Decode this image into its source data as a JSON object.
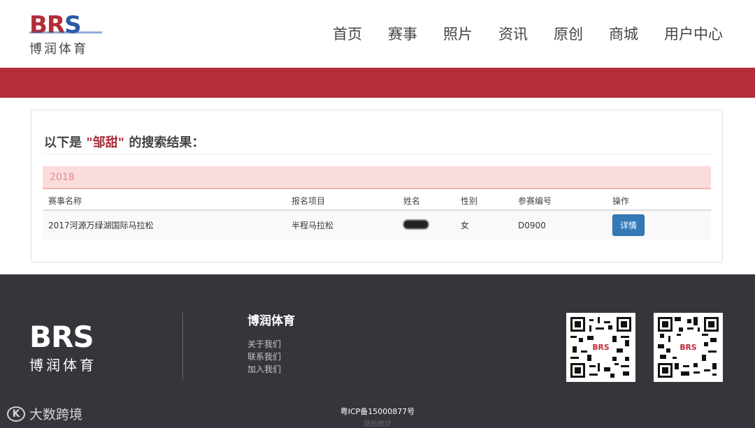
{
  "header": {
    "logo_text": "BRS",
    "logo_cn": "博润体育",
    "nav": [
      "首页",
      "赛事",
      "照片",
      "资讯",
      "原创",
      "商城",
      "用户中心"
    ]
  },
  "results": {
    "title_prefix": "以下是",
    "keyword": "\"邹甜\"",
    "title_suffix": "的搜索结果：",
    "year": "2018",
    "columns": [
      "赛事名称",
      "报名项目",
      "姓名",
      "性别",
      "参赛编号",
      "操作"
    ],
    "rows": [
      {
        "event": "2017河源万绿湖国际马拉松",
        "item": "半程马拉松",
        "name": "",
        "gender": "女",
        "bib": "D0900",
        "action": "详情"
      }
    ]
  },
  "footer": {
    "logo_text": "BRS",
    "logo_cn": "博润体育",
    "company": "博润体育",
    "links": [
      "关于我们",
      "联系我们",
      "加入我们"
    ],
    "qr_label": "BRS",
    "icp": "粤ICP备15000877号",
    "stat": "站长统计",
    "watermark": "大数跨境"
  },
  "colors": {
    "brand_red": "#b42d38",
    "brand_blue": "#2a5aa8",
    "button_blue": "#3479b7",
    "footer_bg": "#35363b"
  }
}
